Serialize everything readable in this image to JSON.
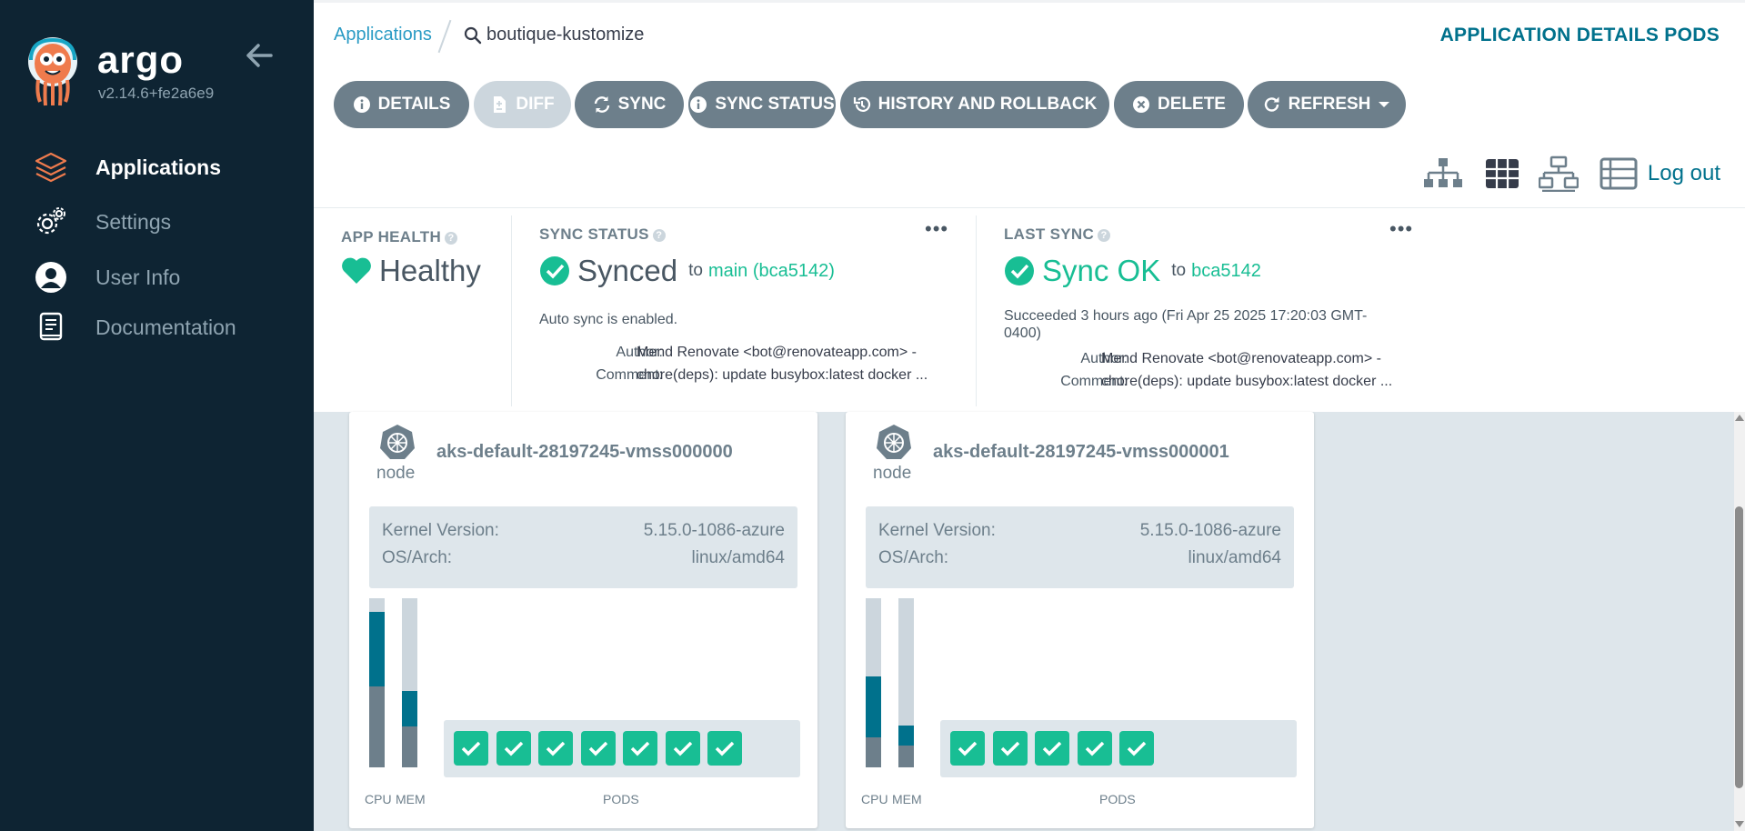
{
  "sidebar": {
    "brand": "argo",
    "version": "v2.14.6+fe2a6e9",
    "items": [
      {
        "label": "Applications",
        "icon": "layers-icon"
      },
      {
        "label": "Settings",
        "icon": "gear-icon"
      },
      {
        "label": "User Info",
        "icon": "user-icon"
      },
      {
        "label": "Documentation",
        "icon": "book-icon"
      }
    ]
  },
  "breadcrumb": {
    "root": "Applications",
    "current": "boutique-kustomize"
  },
  "header": {
    "title": "APPLICATION DETAILS PODS"
  },
  "toolbar": {
    "buttons": [
      {
        "label": "DETAILS",
        "icon": "info-icon"
      },
      {
        "label": "DIFF",
        "icon": "file-diff-icon",
        "disabled": true
      },
      {
        "label": "SYNC",
        "icon": "sync-icon"
      },
      {
        "label": "SYNC STATUS",
        "icon": "info-icon"
      },
      {
        "label": "HISTORY AND ROLLBACK",
        "icon": "history-icon"
      },
      {
        "label": "DELETE",
        "icon": "times-circle-icon"
      },
      {
        "label": "REFRESH",
        "icon": "redo-icon"
      }
    ],
    "logout": "Log out"
  },
  "status": {
    "app_health": {
      "title": "APP HEALTH",
      "value": "Healthy"
    },
    "sync_status": {
      "title": "SYNC STATUS",
      "value": "Synced",
      "to_label": "to",
      "revision": "main (bca5142)",
      "auto_sync": "Auto sync is enabled.",
      "author_label": "Author:",
      "author": "Mend Renovate <bot@renovateapp.com> -",
      "comment_label": "Comment:",
      "comment": "chore(deps): update busybox:latest docker ..."
    },
    "last_sync": {
      "title": "LAST SYNC",
      "value": "Sync OK",
      "to_label": "to",
      "revision": "bca5142",
      "succeeded": "Succeeded 3 hours ago (Fri Apr 25 2025 17:20:03 GMT-0400)",
      "author_label": "Author:",
      "author": "Mend Renovate <bot@renovateapp.com> -",
      "comment_label": "Comment:",
      "comment": "chore(deps): update busybox:latest docker ..."
    }
  },
  "nodes": [
    {
      "kind": "node",
      "name": "aks-default-28197245-vmss000000",
      "kernel_label": "Kernel Version:",
      "kernel": "5.15.0-1086-azure",
      "os_label": "OS/Arch:",
      "os": "linux/amd64",
      "cpu_label": "CPU",
      "mem_label": "MEM",
      "pods_label": "PODS",
      "cpu_requests": 0.44,
      "cpu_usage": 0.48,
      "mem_requests": 0.21,
      "mem_usage": 0.24,
      "pod_count": 7
    },
    {
      "kind": "node",
      "name": "aks-default-28197245-vmss000001",
      "kernel_label": "Kernel Version:",
      "kernel": "5.15.0-1086-azure",
      "os_label": "OS/Arch:",
      "os": "linux/amd64",
      "cpu_label": "CPU",
      "mem_label": "MEM",
      "pods_label": "PODS",
      "cpu_requests": 0.36,
      "cpu_usage": 0.18,
      "mem_requests": 0.12,
      "mem_usage": 0.13,
      "pod_count": 5
    }
  ],
  "colors": {
    "sidebar_bg": "#0e2433",
    "accent": "#00718c",
    "link": "#2a9bc4",
    "success": "#18be94",
    "button": "#6d7f8b",
    "button_disabled": "#ccd6dd",
    "bar_request": "#00718c",
    "bar_usage": "#6d7f8b"
  }
}
